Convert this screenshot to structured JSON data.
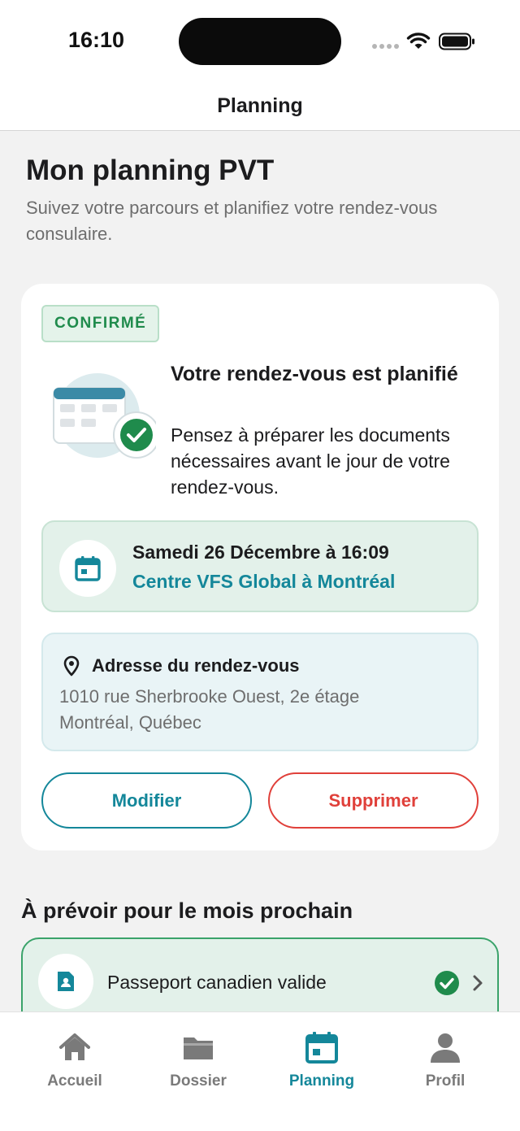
{
  "status_bar": {
    "time": "16:10"
  },
  "header": {
    "title": "Planning"
  },
  "page": {
    "title": "Mon planning PVT",
    "subtitle": "Suivez votre parcours et planifiez votre rendez-vous consulaire."
  },
  "appointment_card": {
    "status_badge": "CONFIRMÉ",
    "heading": "Votre rendez-vous est planifié",
    "message": "Pensez à préparer les documents nécessaires avant le jour de votre rendez-vous.",
    "date_time": "Samedi 26 Décembre à 16:09",
    "center_name": "Centre VFS Global à Montréal",
    "address_title": "Adresse du rendez-vous",
    "address_line1": "1010 rue Sherbrooke Ouest, 2e étage",
    "address_line2": "Montréal, Québec",
    "modify_label": "Modifier",
    "delete_label": "Supprimer"
  },
  "next_month": {
    "title": "À prévoir pour le mois prochain",
    "items": [
      {
        "label": "Passeport canadien valide",
        "done": true
      }
    ]
  },
  "tab_bar": {
    "tabs": [
      {
        "label": "Accueil",
        "icon": "home-icon"
      },
      {
        "label": "Dossier",
        "icon": "folder-icon"
      },
      {
        "label": "Planning",
        "icon": "calendar-icon",
        "active": true
      },
      {
        "label": "Profil",
        "icon": "person-icon"
      }
    ]
  },
  "colors": {
    "accent": "#14879a",
    "success": "#1f8b4c",
    "danger": "#e0403a",
    "inactive": "#7a7a7a"
  }
}
